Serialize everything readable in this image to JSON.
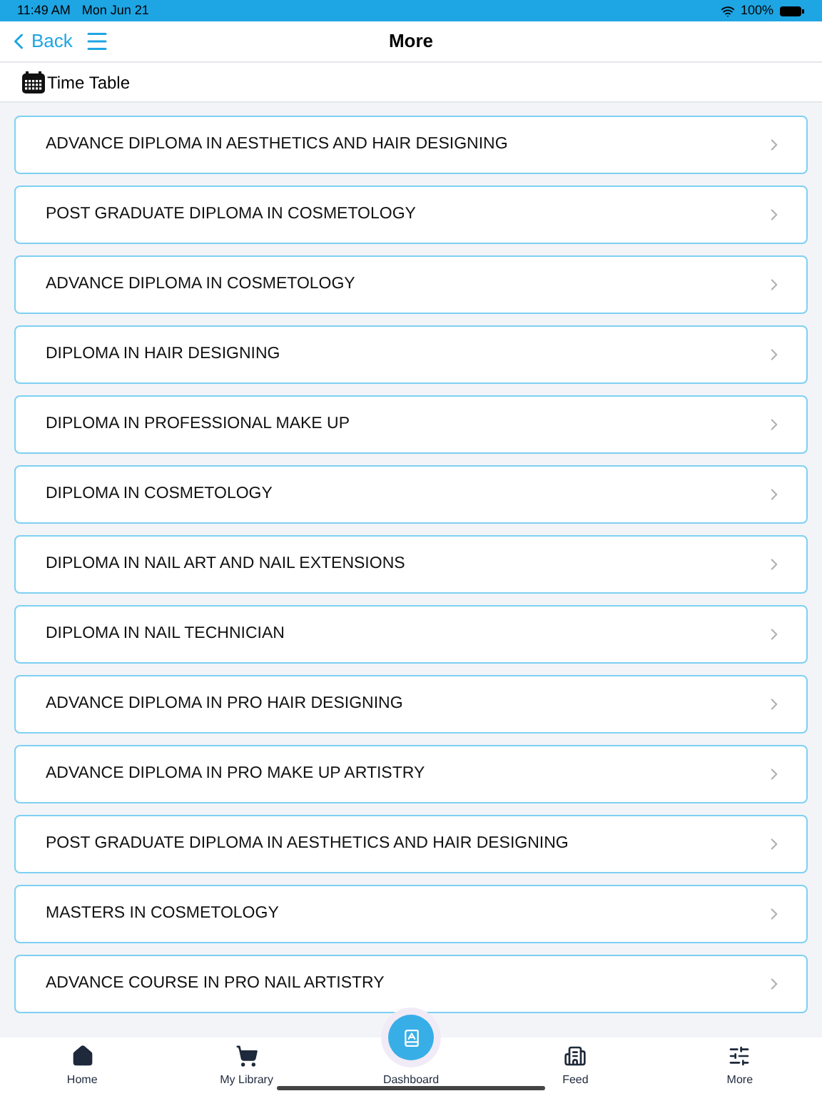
{
  "status_bar": {
    "time": "11:49 AM",
    "date": "Mon Jun 21",
    "battery": "100%"
  },
  "nav": {
    "back": "Back",
    "title": "More"
  },
  "section": {
    "label": "Time Table"
  },
  "courses": [
    {
      "label": "ADVANCE DIPLOMA IN AESTHETICS AND HAIR DESIGNING"
    },
    {
      "label": "POST GRADUATE DIPLOMA IN COSMETOLOGY"
    },
    {
      "label": "ADVANCE DIPLOMA IN COSMETOLOGY"
    },
    {
      "label": "DIPLOMA IN HAIR DESIGNING"
    },
    {
      "label": "DIPLOMA IN PROFESSIONAL MAKE UP"
    },
    {
      "label": "DIPLOMA IN COSMETOLOGY"
    },
    {
      "label": "DIPLOMA IN NAIL ART AND NAIL EXTENSIONS"
    },
    {
      "label": "DIPLOMA IN NAIL TECHNICIAN"
    },
    {
      "label": "ADVANCE DIPLOMA IN PRO HAIR DESIGNING"
    },
    {
      "label": "ADVANCE DIPLOMA IN PRO MAKE UP ARTISTRY"
    },
    {
      "label": "POST GRADUATE DIPLOMA IN AESTHETICS AND HAIR DESIGNING"
    },
    {
      "label": "MASTERS IN COSMETOLOGY"
    },
    {
      "label": "ADVANCE COURSE IN PRO NAIL ARTISTRY"
    }
  ],
  "tab_bar": [
    {
      "kind": "home",
      "label": "Home"
    },
    {
      "kind": "library",
      "label": "My Library"
    },
    {
      "kind": "dashboard",
      "label": "Dashboard"
    },
    {
      "kind": "feed",
      "label": "Feed"
    },
    {
      "kind": "more",
      "label": "More"
    }
  ]
}
